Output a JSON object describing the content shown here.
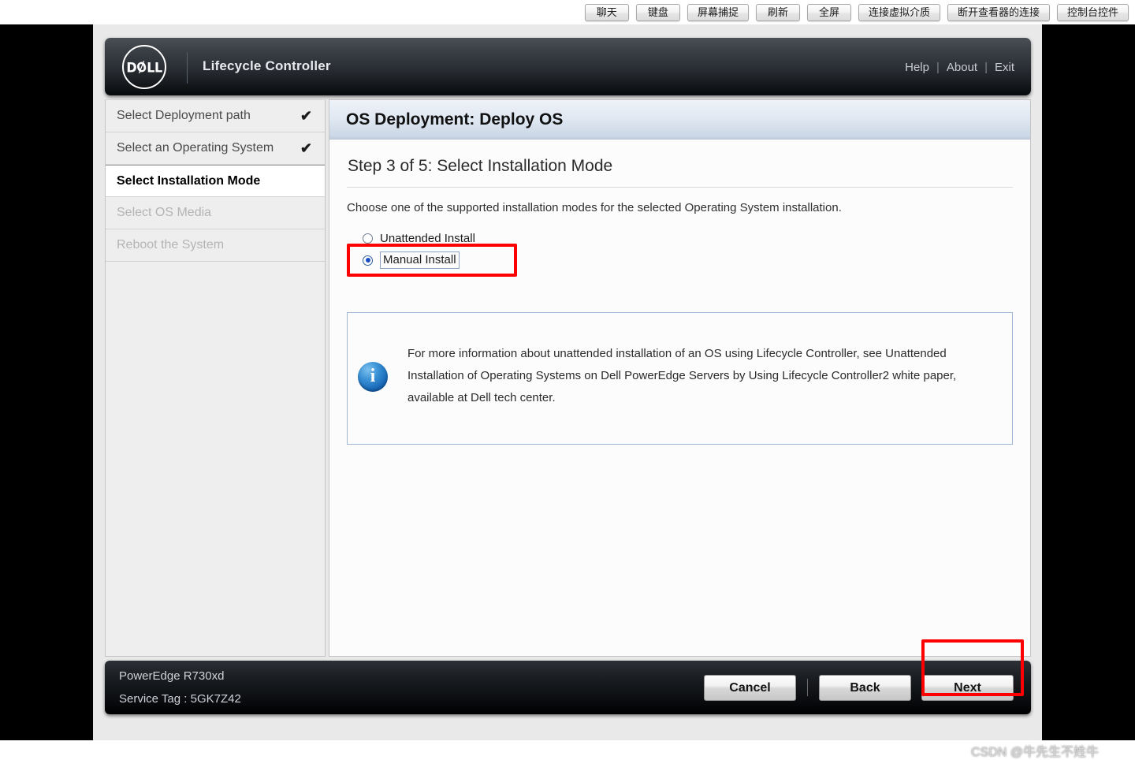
{
  "viewer_toolbar": {
    "buttons": [
      {
        "label": "聊天",
        "name": "chat"
      },
      {
        "label": "键盘",
        "name": "keyboard"
      },
      {
        "label": "屏幕捕捉",
        "name": "screen-capture"
      },
      {
        "label": "刷新",
        "name": "refresh"
      },
      {
        "label": "全屏",
        "name": "fullscreen"
      },
      {
        "label": "连接虚拟介质",
        "name": "connect-virtual-media"
      },
      {
        "label": "断开查看器的连接",
        "name": "disconnect-viewer"
      },
      {
        "label": "控制台控件",
        "name": "console-controls"
      }
    ]
  },
  "header": {
    "logo_text": "DØLL",
    "app_title": "Lifecycle Controller",
    "links": [
      {
        "label": "Help"
      },
      {
        "label": "About"
      },
      {
        "label": "Exit"
      }
    ],
    "separator": "|"
  },
  "sidebar": {
    "items": [
      {
        "label": "Select Deployment path",
        "state": "done",
        "check": "✔"
      },
      {
        "label": "Select an Operating System",
        "state": "done",
        "check": "✔"
      },
      {
        "label": "Select Installation Mode",
        "state": "active",
        "check": ""
      },
      {
        "label": "Select OS Media",
        "state": "disabled",
        "check": ""
      },
      {
        "label": "Reboot the System",
        "state": "disabled",
        "check": ""
      }
    ]
  },
  "content": {
    "title": "OS Deployment: Deploy OS",
    "step_title": "Step 3 of 5: Select Installation Mode",
    "description": "Choose one of the supported installation modes for the selected Operating System installation.",
    "options": [
      {
        "label": "Unattended Install",
        "selected": false
      },
      {
        "label": "Manual Install",
        "selected": true
      }
    ],
    "info": {
      "icon": "info-icon",
      "text": "For more information about unattended installation of an OS using Lifecycle Controller, see Unattended Installation of Operating Systems on Dell PowerEdge Servers by Using Lifecycle Controller2 white paper, available at Dell tech center."
    }
  },
  "footer": {
    "system_model": "PowerEdge R730xd",
    "service_tag": "Service Tag : 5GK7Z42",
    "buttons": [
      {
        "label": "Cancel",
        "name": "cancel"
      },
      {
        "label": "Back",
        "name": "back"
      },
      {
        "label": "Next",
        "name": "next"
      }
    ]
  },
  "annotations": {
    "color": "#ff0000",
    "watermark": "CSDN @牛先生不姓牛"
  }
}
